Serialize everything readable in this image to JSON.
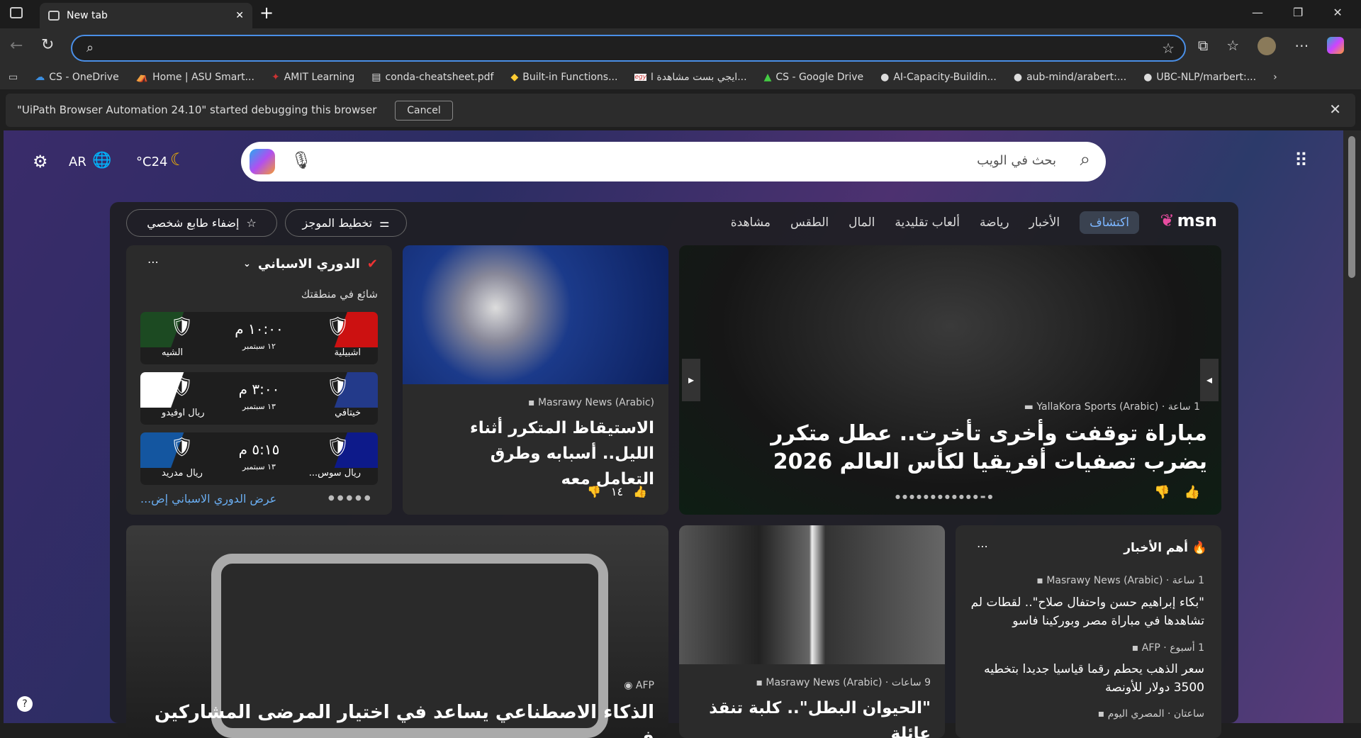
{
  "browser": {
    "tab_title": "New tab",
    "bookmarks": [
      "CS - OneDrive",
      "Home | ASU Smart...",
      "AMIT Learning",
      "conda-cheatsheet.pdf",
      "Built-in Functions...",
      "ايجي بست مشاهدة ا...",
      "CS - Google Drive",
      "AI-Capacity-Buildin...",
      "aub-mind/arabert:...",
      "UBC-NLP/marbert:..."
    ],
    "infobar": {
      "message": "\"UiPath Browser Automation 24.10\" started debugging this browser",
      "cancel": "Cancel"
    }
  },
  "msn": {
    "lang": "AR",
    "temp": "24",
    "temp_unit": "°C",
    "search_placeholder": "بحث في الويب",
    "logo": "msn",
    "nav": [
      "اكتشاف",
      "الأخبار",
      "رياضة",
      "ألعاب تقليدية",
      "المال",
      "الطقس",
      "مشاهدة"
    ],
    "personalize": "إضفاء طابع شخصي",
    "layout": "تخطيط الموجز"
  },
  "sports": {
    "title": "الدوري الاسباني",
    "subtitle": "شائع في منطقتك",
    "more": "عرض الدوري الاسباني إض...",
    "matches": [
      {
        "home": "اشبيلية",
        "away": "الشيه",
        "time": "١٠:٠٠ م",
        "date": "١٢ سبتمبر"
      },
      {
        "home": "خيتافي",
        "away": "ريال اوفيدو",
        "time": "٣:٠٠ م",
        "date": "١٣ سبتمبر"
      },
      {
        "home": "ريال سوس...",
        "away": "ريال مدريد",
        "time": "٥:١٥ م",
        "date": "١٣ سبتمبر"
      }
    ]
  },
  "sleep_card": {
    "source": "Masrawy News (Arabic)",
    "title": "الاستيقاظ المتكرر أثناء الليل.. أسبابه وطرق التعامل معه",
    "likes": "١٤"
  },
  "hero": {
    "source": "YallaKora Sports (Arabic)",
    "time": "1 ساعة",
    "title": "مباراة توقفت وأخرى تأخرت.. عطل متكرر يضرب تصفيات أفريقيا لكأس العالم 2026"
  },
  "ai_card": {
    "source": "AFP",
    "title": "الذكاء الاصطناعي يساعد في اختيار المرضى المشاركين في"
  },
  "dog_card": {
    "source": "Masrawy News (Arabic)",
    "time": "9 ساعات",
    "title": "\"الحيوان البطل\".. كلبة تنقذ عائلة"
  },
  "top_news": {
    "title": "أهم الأخبار",
    "items": [
      {
        "source": "Masrawy News (Arabic)",
        "time": "1 ساعة",
        "title": "\"بكاء إبراهيم حسن واحتفال صلاح\".. لقطات لم تشاهدها في مباراة مصر وبوركينا فاسو"
      },
      {
        "source": "AFP",
        "time": "1 أسبوع",
        "title": "سعر الذهب يحطم رقما قياسيا جديدا بتخطيه 3500 دولار للأونصة"
      },
      {
        "source": "المصري اليوم",
        "time": "ساعتان",
        "title": ""
      }
    ]
  }
}
